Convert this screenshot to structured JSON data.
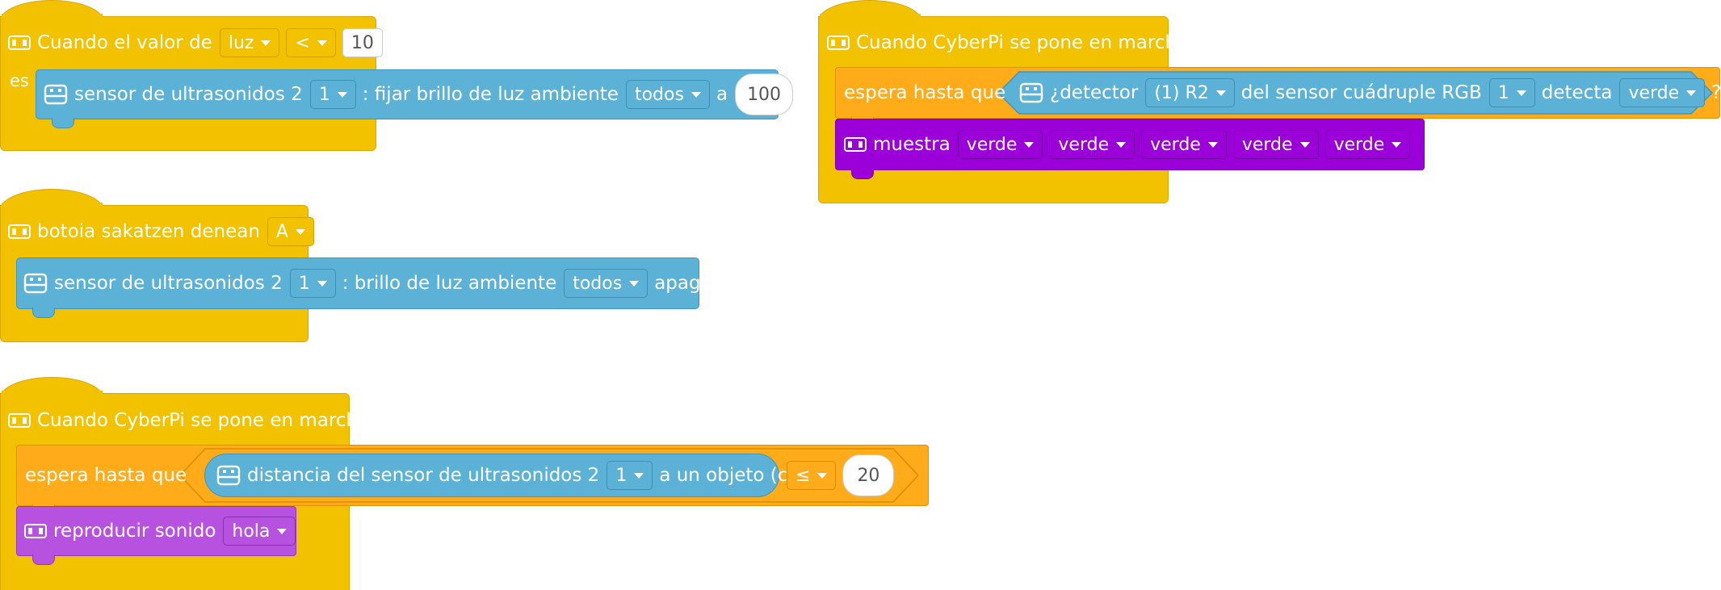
{
  "scripts": [
    {
      "hat": {
        "label": "Cuando el valor de",
        "sensor": "luz",
        "operator": "<",
        "value": "10"
      },
      "c_label": "es",
      "block": {
        "label": "sensor de ultrasonidos 2",
        "port": "1",
        "action": ": fijar brillo de luz ambiente",
        "target": "todos",
        "connector": "a",
        "value": "100",
        "unit": "%"
      }
    },
    {
      "hat": {
        "label": "botoia sakatzen denean",
        "button": "A"
      },
      "block": {
        "label": "sensor de ultrasonidos 2",
        "port": "1",
        "action": ": brillo de luz ambiente",
        "target": "todos",
        "state": "apagada"
      }
    },
    {
      "hat": {
        "label": "Cuando CyberPi se pone en marcha"
      },
      "wait": {
        "label": "espera hasta que",
        "reporter": {
          "label": "distancia del sensor de ultrasonidos 2",
          "port": "1",
          "suffix": "a un objeto (cm)"
        },
        "operator": "≤",
        "value": "20"
      },
      "sound": {
        "label": "reproducir sonido",
        "sound": "hola"
      }
    },
    {
      "hat": {
        "label": "Cuando CyberPi se pone en marcha"
      },
      "wait": {
        "label": "espera hasta que",
        "predicate": {
          "label": "¿detector",
          "channel": "(1) R2",
          "middle": "del sensor cuádruple RGB",
          "port": "1",
          "verb": "detecta",
          "color": "verde",
          "end": "?"
        }
      },
      "show": {
        "label": "muestra",
        "colors": [
          "verde",
          "verde",
          "verde",
          "verde",
          "verde"
        ]
      }
    }
  ],
  "colors": {
    "event_yellow": "#f2c200",
    "sensor_blue": "#5cb1d6",
    "control_orange": "#ffab1a",
    "light_purple": "#9b00d9",
    "sound_violet": "#b752e0"
  },
  "icons": [
    "cyberpi-icon",
    "sensor-icon",
    "dropdown-caret-icon"
  ]
}
